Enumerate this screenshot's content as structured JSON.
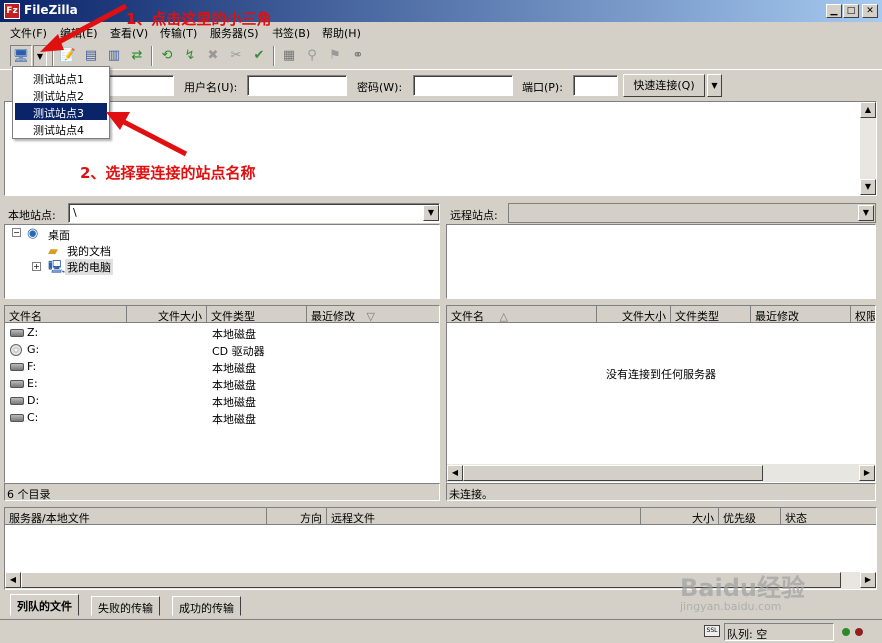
{
  "window": {
    "title": "FileZilla",
    "icon_text": "Fz"
  },
  "menu": [
    {
      "label": "文件(F)",
      "name": "menu-file"
    },
    {
      "label": "编辑(E)",
      "name": "menu-edit"
    },
    {
      "label": "查看(V)",
      "name": "menu-view"
    },
    {
      "label": "传输(T)",
      "name": "menu-transfer"
    },
    {
      "label": "服务器(S)",
      "name": "menu-server"
    },
    {
      "label": "书签(B)",
      "name": "menu-bookmarks"
    },
    {
      "label": "帮助(H)",
      "name": "menu-help"
    }
  ],
  "site_menu": {
    "items": [
      "测试站点1",
      "测试站点2",
      "测试站点3",
      "测试站点4"
    ],
    "selected_index": 2
  },
  "annotations": {
    "step1": "1、点击这里的小三角",
    "step2": "2、选择要连接的站点名称"
  },
  "quickconnect": {
    "host_value": "",
    "user_label": "用户名(U):",
    "user_value": "",
    "pass_label": "密码(W):",
    "pass_value": "",
    "port_label": "端口(P):",
    "port_value": "",
    "button_label": "快速连接(Q)"
  },
  "local": {
    "site_label": "本地站点:",
    "path": "\\",
    "tree": [
      {
        "label": "桌面",
        "icon": "desktop-icon"
      },
      {
        "label": "我的文档",
        "icon": "folder-icon"
      },
      {
        "label": "我的电脑",
        "icon": "computer-icon"
      }
    ],
    "columns": [
      "文件名",
      "文件大小",
      "文件类型",
      "最近修改"
    ],
    "files": [
      {
        "name": "Z:",
        "type": "本地磁盘",
        "icon": "disk"
      },
      {
        "name": "G:",
        "type": "CD 驱动器",
        "icon": "cd"
      },
      {
        "name": "F:",
        "type": "本地磁盘",
        "icon": "disk"
      },
      {
        "name": "E:",
        "type": "本地磁盘",
        "icon": "disk"
      },
      {
        "name": "D:",
        "type": "本地磁盘",
        "icon": "disk"
      },
      {
        "name": "C:",
        "type": "本地磁盘",
        "icon": "disk"
      }
    ],
    "status": "6 个目录"
  },
  "remote": {
    "site_label": "远程站点:",
    "path": "",
    "columns": [
      "文件名",
      "文件大小",
      "文件类型",
      "最近修改",
      "权限"
    ],
    "empty_message": "没有连接到任何服务器",
    "status": "未连接。"
  },
  "queue": {
    "columns": [
      "服务器/本地文件",
      "方向",
      "远程文件",
      "大小",
      "优先级",
      "状态"
    ],
    "tabs": [
      "列队的文件",
      "失败的传输",
      "成功的传输"
    ],
    "status": "队列: 空"
  },
  "watermark": {
    "brand": "Baidu经验",
    "url": "jingyan.baidu.com"
  },
  "colors": {
    "titlebar": "#0a246a",
    "selection": "#0a246a",
    "annotation": "#e01010",
    "chrome": "#d4d0c8"
  }
}
